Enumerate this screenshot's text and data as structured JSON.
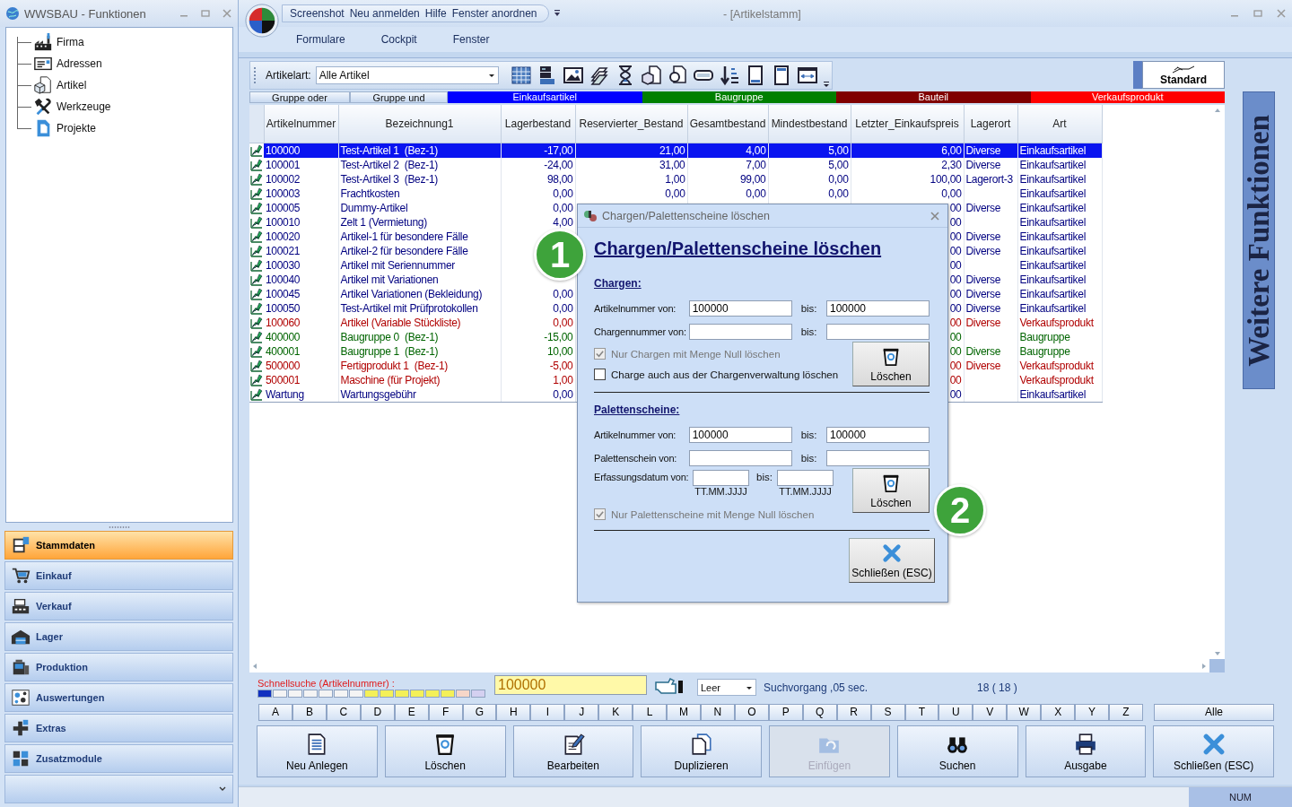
{
  "left_window": {
    "title": "WWSBAU - Funktionen",
    "tree": [
      {
        "label": "Firma"
      },
      {
        "label": "Adressen"
      },
      {
        "label": "Artikel"
      },
      {
        "label": "Werkzeuge"
      },
      {
        "label": "Projekte"
      }
    ],
    "nav": [
      {
        "label": "Stammdaten",
        "selected": true
      },
      {
        "label": "Einkauf",
        "selected": false
      },
      {
        "label": "Verkauf",
        "selected": false
      },
      {
        "label": "Lager",
        "selected": false
      },
      {
        "label": "Produktion",
        "selected": false
      },
      {
        "label": "Auswertungen",
        "selected": false
      },
      {
        "label": "Extras",
        "selected": false
      },
      {
        "label": "Zusatzmodule",
        "selected": false
      }
    ]
  },
  "main_window": {
    "title": "- [Artikelstamm]",
    "quick_access": [
      "Screenshot",
      "Neu anmelden",
      "Hilfe",
      "Fenster anordnen"
    ],
    "menu": [
      "Formulare",
      "Cockpit",
      "Fenster"
    ]
  },
  "toolbar": {
    "filter_label": "Artikelart:",
    "filter_value": "Alle Artikel",
    "standard_button": "Standard"
  },
  "legend": [
    {
      "kind": "button",
      "label": "Gruppe oder"
    },
    {
      "kind": "button",
      "label": "Gruppe und"
    },
    {
      "kind": "color",
      "label": "Einkaufsartikel",
      "color": "#0000ff"
    },
    {
      "kind": "color",
      "label": "Baugruppe",
      "color": "#008000"
    },
    {
      "kind": "color",
      "label": "Bauteil",
      "color": "#800000"
    },
    {
      "kind": "color",
      "label": "Verkaufsprodukt",
      "color": "#ff0000"
    }
  ],
  "table": {
    "columns": [
      "Artikelnummer",
      "Bezeichnung1",
      "Lagerbestand",
      "Reservierter_Bestand",
      "Gesamtbestand",
      "Mindestbestand",
      "Letzter_Einkaufspreis",
      "Lagerort",
      "Art"
    ],
    "rows": [
      {
        "selected": true,
        "artikelnummer": "100000",
        "bezeichnung1": "Test-Artikel 1  (Bez-1)",
        "lagerbestand": "-17,00",
        "reservierter_bestand": "21,00",
        "gesamtbestand": "4,00",
        "mindestbestand": "5,00",
        "letzter_einkaufspreis": "6,00",
        "lagerort": "Diverse",
        "art": "Einkaufsartikel"
      },
      {
        "selected": false,
        "color": "#000080",
        "artikelnummer": "100001",
        "bezeichnung1": "Test-Artikel 2  (Bez-1)",
        "lagerbestand": "-24,00",
        "reservierter_bestand": "31,00",
        "gesamtbestand": "7,00",
        "mindestbestand": "5,00",
        "letzter_einkaufspreis": "2,30",
        "lagerort": "Diverse",
        "art": "Einkaufsartikel"
      },
      {
        "selected": false,
        "color": "#000080",
        "artikelnummer": "100002",
        "bezeichnung1": "Test-Artikel 3  (Bez-1)",
        "lagerbestand": "98,00",
        "reservierter_bestand": "1,00",
        "gesamtbestand": "99,00",
        "mindestbestand": "0,00",
        "letzter_einkaufspreis": "100,00",
        "lagerort": "Lagerort-3",
        "art": "Einkaufsartikel"
      },
      {
        "selected": false,
        "color": "#000080",
        "artikelnummer": "100003",
        "bezeichnung1": "Frachtkosten",
        "lagerbestand": "0,00",
        "reservierter_bestand": "0,00",
        "gesamtbestand": "0,00",
        "mindestbestand": "0,00",
        "letzter_einkaufspreis": "0,00",
        "art": "Einkaufsartikel"
      },
      {
        "selected": false,
        "color": "#000080",
        "artikelnummer": "100005",
        "bezeichnung1": "Dummy-Artikel",
        "lagerbestand": "0,00",
        "letzter_einkaufspreis": "00",
        "lagerort": "Diverse",
        "art": "Einkaufsartikel"
      },
      {
        "selected": false,
        "color": "#000080",
        "artikelnummer": "100010",
        "bezeichnung1": "Zelt 1 (Vermietung)",
        "lagerbestand": "4,00",
        "letzter_einkaufspreis": "00",
        "art": "Einkaufsartikel"
      },
      {
        "selected": false,
        "color": "#000080",
        "artikelnummer": "100020",
        "bezeichnung1": "Artikel-1 für besondere Fälle",
        "letzter_einkaufspreis": "00",
        "lagerort": "Diverse",
        "art": "Einkaufsartikel"
      },
      {
        "selected": false,
        "color": "#000080",
        "artikelnummer": "100021",
        "bezeichnung1": "Artikel-2 für besondere Fälle",
        "letzter_einkaufspreis": "00",
        "lagerort": "Diverse",
        "art": "Einkaufsartikel"
      },
      {
        "selected": false,
        "color": "#000080",
        "artikelnummer": "100030",
        "bezeichnung1": "Artikel mit Seriennummer",
        "letzter_einkaufspreis": "00",
        "art": "Einkaufsartikel"
      },
      {
        "selected": false,
        "color": "#000080",
        "artikelnummer": "100040",
        "bezeichnung1": "Artikel mit Variationen",
        "letzter_einkaufspreis": "00",
        "lagerort": "Diverse",
        "art": "Einkaufsartikel"
      },
      {
        "selected": false,
        "color": "#000080",
        "artikelnummer": "100045",
        "bezeichnung1": "Artikel Variationen (Bekleidung)",
        "lagerbestand": "0,00",
        "letzter_einkaufspreis": "00",
        "lagerort": "Diverse",
        "art": "Einkaufsartikel"
      },
      {
        "selected": false,
        "color": "#000080",
        "artikelnummer": "100050",
        "bezeichnung1": "Test-Artikel mit Prüfprotokollen",
        "lagerbestand": "0,00",
        "letzter_einkaufspreis": "00",
        "lagerort": "Diverse",
        "art": "Einkaufsartikel"
      },
      {
        "selected": false,
        "color": "#b00000",
        "artikelnummer": "100060",
        "bezeichnung1": "Artikel (Variable Stückliste)",
        "lagerbestand": "0,00",
        "letzter_einkaufspreis": "00",
        "lagerort": "Diverse",
        "art": "Verkaufsprodukt"
      },
      {
        "selected": false,
        "color": "#006400",
        "artikelnummer": "400000",
        "bezeichnung1": "Baugruppe 0  (Bez-1)",
        "lagerbestand": "-15,00",
        "letzter_einkaufspreis": "00",
        "art": "Baugruppe"
      },
      {
        "selected": false,
        "color": "#006400",
        "artikelnummer": "400001",
        "bezeichnung1": "Baugruppe 1  (Bez-1)",
        "lagerbestand": "10,00",
        "letzter_einkaufspreis": "00",
        "lagerort": "Diverse",
        "art": "Baugruppe"
      },
      {
        "selected": false,
        "color": "#b00000",
        "artikelnummer": "500000",
        "bezeichnung1": "Fertigprodukt 1  (Bez-1)",
        "lagerbestand": "-5,00",
        "letzter_einkaufspreis": "00",
        "lagerort": "Diverse",
        "art": "Verkaufsprodukt"
      },
      {
        "selected": false,
        "color": "#b00000",
        "artikelnummer": "500001",
        "bezeichnung1": "Maschine (für Projekt)",
        "lagerbestand": "1,00",
        "letzter_einkaufspreis": "00",
        "art": "Verkaufsprodukt"
      },
      {
        "selected": false,
        "color": "#000080",
        "artikelnummer": "Wartung",
        "bezeichnung1": "Wartungsgebühr",
        "lagerbestand": "0,00",
        "letzter_einkaufspreis": "00",
        "art": "Einkaufsartikel"
      }
    ]
  },
  "side_tab": {
    "label": "Weitere Funktionen"
  },
  "quick_search": {
    "label": "Schnellsuche (Artikelnummer) :",
    "value": "100000",
    "mode": "Leer",
    "duration": "Suchvorgang ,05 sec.",
    "count": "18 ( 18 )"
  },
  "letters": [
    "A",
    "B",
    "C",
    "D",
    "E",
    "F",
    "G",
    "H",
    "I",
    "J",
    "K",
    "L",
    "M",
    "N",
    "O",
    "P",
    "Q",
    "R",
    "S",
    "T",
    "U",
    "V",
    "W",
    "X",
    "Y",
    "Z"
  ],
  "all_button": "Alle",
  "actions": [
    {
      "label": "Neu Anlegen",
      "disabled": false
    },
    {
      "label": "Löschen",
      "disabled": false
    },
    {
      "label": "Bearbeiten",
      "disabled": false
    },
    {
      "label": "Duplizieren",
      "disabled": false
    },
    {
      "label": "Einfügen",
      "disabled": true
    },
    {
      "label": "Suchen",
      "disabled": false
    },
    {
      "label": "Ausgabe",
      "disabled": false
    },
    {
      "label": "Schließen (ESC)",
      "disabled": false
    }
  ],
  "status_bar": {
    "num": "NUM"
  },
  "dialog": {
    "title": "Chargen/Palettenscheine löschen",
    "heading": "Chargen/Palettenscheine löschen",
    "sections": [
      {
        "heading": "Chargen:",
        "fields": [
          {
            "kind": "text",
            "label": "Artikelnummer von:",
            "from": "100000",
            "to_label": "bis:",
            "to": "100000"
          },
          {
            "kind": "text",
            "label": "Chargennummer von:",
            "to_label": "bis:"
          }
        ],
        "checkboxes": [
          {
            "label": "Nur Chargen mit Menge Null löschen",
            "checked": true,
            "disabled": true
          },
          {
            "label": "Charge auch aus der Chargenverwaltung löschen",
            "checked": false,
            "disabled": false
          }
        ],
        "button": "Löschen"
      },
      {
        "heading": "Palettenscheine:",
        "fields": [
          {
            "kind": "text",
            "label": "Artikelnummer von:",
            "from": "100000",
            "to_label": "bis:",
            "to": "100000"
          },
          {
            "kind": "text",
            "label": "Palettenschein von:",
            "to_label": "bis:"
          },
          {
            "kind": "date",
            "label": "Erfassungsdatum von:",
            "to_label": "bis:",
            "from_hint": "TT.MM.JJJJ",
            "to_hint": "TT.MM.JJJJ"
          }
        ],
        "checkboxes": [
          {
            "label": "Nur Palettenscheine mit Menge Null löschen",
            "checked": true,
            "disabled": true
          }
        ],
        "button": "Löschen"
      }
    ],
    "close_button": "Schließen (ESC)"
  },
  "badges": [
    "1",
    "2"
  ]
}
